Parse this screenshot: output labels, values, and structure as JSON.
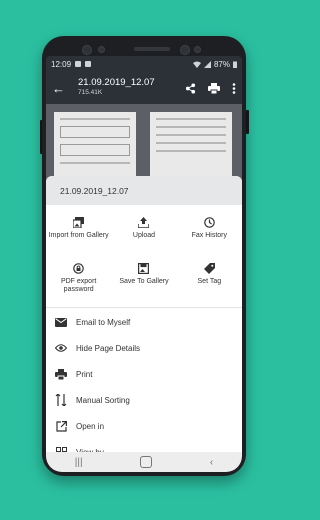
{
  "status_bar": {
    "time": "12:09",
    "battery": "87%"
  },
  "app_bar": {
    "title": "21.09.2019_12.07",
    "subtitle": "715.41K"
  },
  "sheet": {
    "title": "21.09.2019_12.07",
    "grid": [
      {
        "icon": "import-from-gallery-icon",
        "label": "Import from Gallery"
      },
      {
        "icon": "upload-icon",
        "label": "Upload"
      },
      {
        "icon": "fax-history-icon",
        "label": "Fax History"
      },
      {
        "icon": "pdf-password-icon",
        "label": "PDF export password"
      },
      {
        "icon": "save-to-gallery-icon",
        "label": "Save To Gallery"
      },
      {
        "icon": "tag-icon",
        "label": "Set Tag"
      }
    ],
    "list": [
      {
        "icon": "email-icon",
        "label": "Email to Myself"
      },
      {
        "icon": "eye-icon",
        "label": "Hide Page Details"
      },
      {
        "icon": "print-icon",
        "label": "Print"
      },
      {
        "icon": "sort-icon",
        "label": "Manual Sorting"
      },
      {
        "icon": "open-in-icon",
        "label": "Open in"
      },
      {
        "icon": "grid-view-icon",
        "label": "View by"
      }
    ]
  },
  "colors": {
    "background": "#2bbfa0",
    "app_bar": "#2c3138",
    "sheet_header": "#e6e7e8"
  }
}
